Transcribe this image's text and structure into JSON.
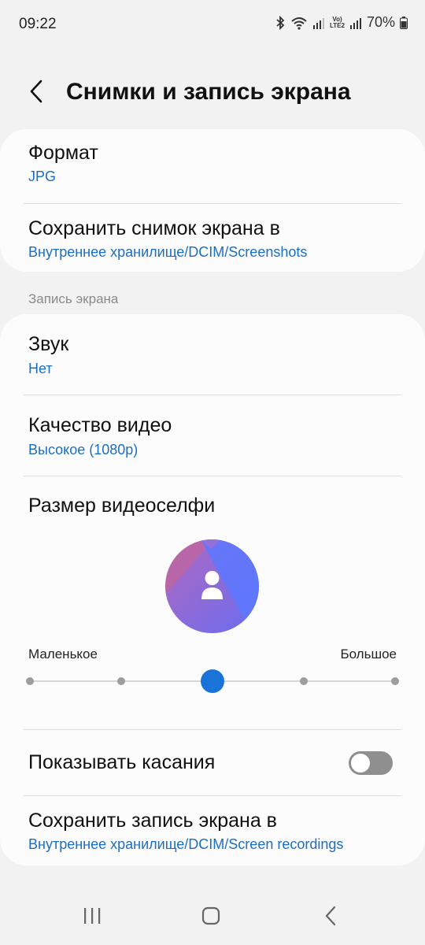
{
  "status": {
    "time": "09:22",
    "battery": "70%",
    "lte_top": "Vo)",
    "lte_bottom": "LTE2"
  },
  "header": {
    "title": "Снимки и запись экрана"
  },
  "screenshots": {
    "format": {
      "title": "Формат",
      "value": "JPG"
    },
    "save_location": {
      "title": "Сохранить снимок экрана в",
      "value": "Внутреннее хранилище/DCIM/Screenshots"
    }
  },
  "recording": {
    "section_label": "Запись экрана",
    "sound": {
      "title": "Звук",
      "value": "Нет"
    },
    "video_quality": {
      "title": "Качество видео",
      "value": "Высокое (1080p)"
    },
    "selfie_size": {
      "title": "Размер видеоселфи",
      "min_label": "Маленькое",
      "max_label": "Большое",
      "steps": 5,
      "selected_step": 2
    },
    "show_touches": {
      "title": "Показывать касания",
      "enabled": false
    },
    "save_location": {
      "title": "Сохранить запись экрана в",
      "value": "Внутреннее хранилище/DCIM/Screen recordings"
    }
  },
  "colors": {
    "accent": "#1a73d9",
    "link": "#1a6fc4",
    "background": "#f2f2f2",
    "card": "#fcfcfc"
  },
  "icons": {
    "back": "chevron-left-icon",
    "nav_recents": "recents-icon",
    "nav_home": "home-icon",
    "nav_back": "back-icon"
  }
}
